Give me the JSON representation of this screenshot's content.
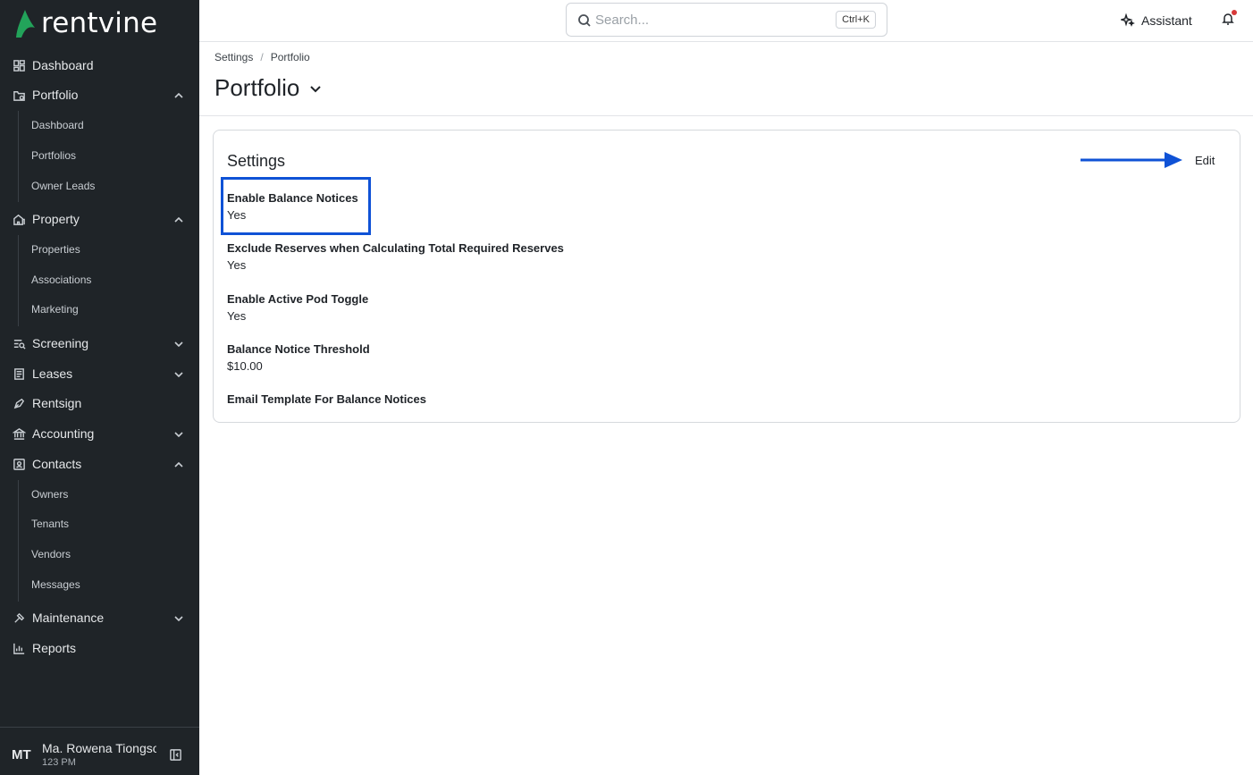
{
  "brand": {
    "name": "rentvine",
    "accent": "#22a35a"
  },
  "sidebar": {
    "nav": [
      {
        "label": "Dashboard",
        "icon": "dashboard-icon"
      },
      {
        "label": "Portfolio",
        "icon": "portfolio-icon",
        "expanded": true,
        "children": [
          "Dashboard",
          "Portfolios",
          "Owner Leads"
        ]
      },
      {
        "label": "Property",
        "icon": "property-icon",
        "expanded": true,
        "children": [
          "Properties",
          "Associations",
          "Marketing"
        ]
      },
      {
        "label": "Screening",
        "icon": "screening-icon",
        "expanded": false
      },
      {
        "label": "Leases",
        "icon": "leases-icon",
        "expanded": false
      },
      {
        "label": "Rentsign",
        "icon": "rentsign-icon"
      },
      {
        "label": "Accounting",
        "icon": "accounting-icon",
        "expanded": false
      },
      {
        "label": "Contacts",
        "icon": "contacts-icon",
        "expanded": true,
        "children": [
          "Owners",
          "Tenants",
          "Vendors",
          "Messages"
        ]
      },
      {
        "label": "Maintenance",
        "icon": "maintenance-icon",
        "expanded": false
      },
      {
        "label": "Reports",
        "icon": "reports-icon"
      }
    ],
    "user": {
      "initials": "MT",
      "name": "Ma. Rowena Tiongson",
      "subtitle": "123 PM"
    }
  },
  "topbar": {
    "search_placeholder": "Search...",
    "search_shortcut": "Ctrl+K",
    "assistant_label": "Assistant"
  },
  "header": {
    "breadcrumb": [
      "Settings",
      "Portfolio"
    ],
    "title": "Portfolio"
  },
  "card": {
    "title": "Settings",
    "edit_label": "Edit",
    "fields": [
      {
        "label": "Enable Balance Notices",
        "value": "Yes"
      },
      {
        "label": "Exclude Reserves when Calculating Total Required Reserves",
        "value": "Yes"
      },
      {
        "label": "Enable Active Pod Toggle",
        "value": "Yes"
      },
      {
        "label": "Balance Notice Threshold",
        "value": "$10.00"
      },
      {
        "label": "Email Template For Balance Notices",
        "value": ""
      }
    ]
  },
  "annotation_color": "#0f52d6"
}
